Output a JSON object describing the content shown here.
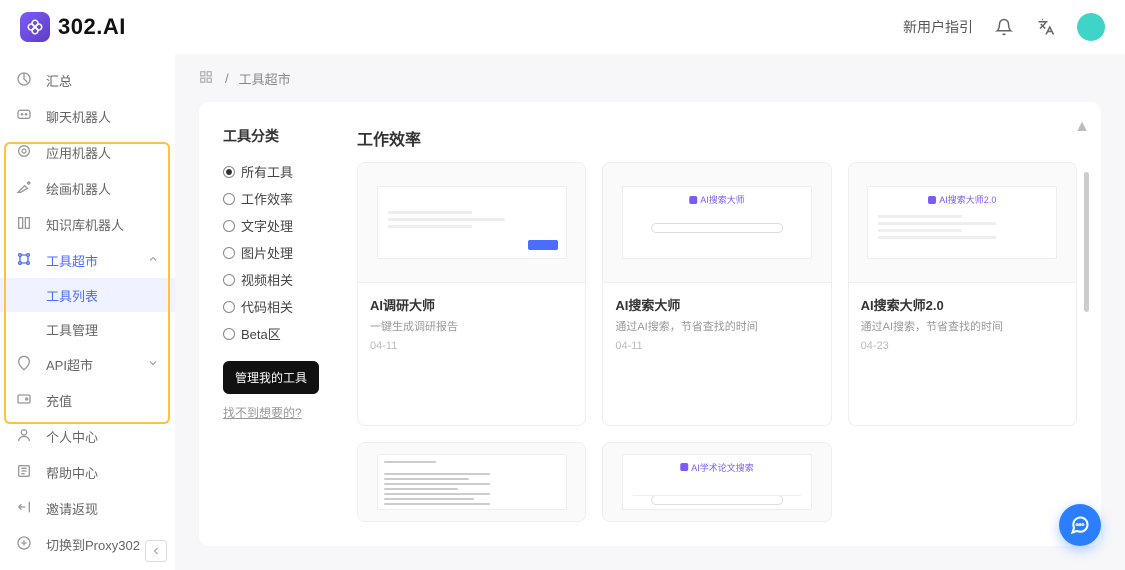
{
  "brand": "302.AI",
  "topbar": {
    "new_user_guide": "新用户指引"
  },
  "sidebar": {
    "items": [
      {
        "icon": "dashboard",
        "label": "汇总"
      },
      {
        "icon": "chat",
        "label": "聊天机器人"
      },
      {
        "icon": "app",
        "label": "应用机器人"
      },
      {
        "icon": "draw",
        "label": "绘画机器人"
      },
      {
        "icon": "knowledge",
        "label": "知识库机器人"
      },
      {
        "icon": "tools",
        "label": "工具超市",
        "active": true,
        "expanded": true,
        "children": [
          {
            "label": "工具列表",
            "active": true
          },
          {
            "label": "工具管理"
          }
        ]
      },
      {
        "icon": "api",
        "label": "API超市",
        "expanded": false
      },
      {
        "icon": "wallet",
        "label": "充值"
      },
      {
        "icon": "user",
        "label": "个人中心"
      },
      {
        "icon": "help",
        "label": "帮助中心"
      },
      {
        "icon": "invite",
        "label": "邀请返现"
      },
      {
        "icon": "swap",
        "label": "切换到Proxy302"
      }
    ]
  },
  "breadcrumb": {
    "separator": "/",
    "current": "工具超市"
  },
  "categories": {
    "title": "工具分类",
    "options": [
      {
        "label": "所有工具",
        "selected": true
      },
      {
        "label": "工作效率"
      },
      {
        "label": "文字处理"
      },
      {
        "label": "图片处理"
      },
      {
        "label": "视频相关"
      },
      {
        "label": "代码相关"
      },
      {
        "label": "Beta区"
      }
    ],
    "manage_btn": "管理我的工具",
    "missing_link": "找不到想要的?"
  },
  "catalog": {
    "heading": "工作效率",
    "cards": [
      {
        "title": "AI调研大师",
        "thumb_label": "",
        "desc": "一键生成调研报告",
        "date": "04-11"
      },
      {
        "title": "AI搜索大师",
        "thumb_label": "AI搜索大师",
        "desc": "通过AI搜索，节省查找的时间",
        "date": "04-11"
      },
      {
        "title": "AI搜索大师2.0",
        "thumb_label": "AI搜索大师2.0",
        "desc": "通过AI搜索，节省查找的时间",
        "date": "04-23"
      },
      {
        "title": "",
        "thumb_label": "",
        "desc": "",
        "date": ""
      },
      {
        "title": "",
        "thumb_label": "AI学术论文搜索",
        "desc": "",
        "date": ""
      }
    ]
  }
}
